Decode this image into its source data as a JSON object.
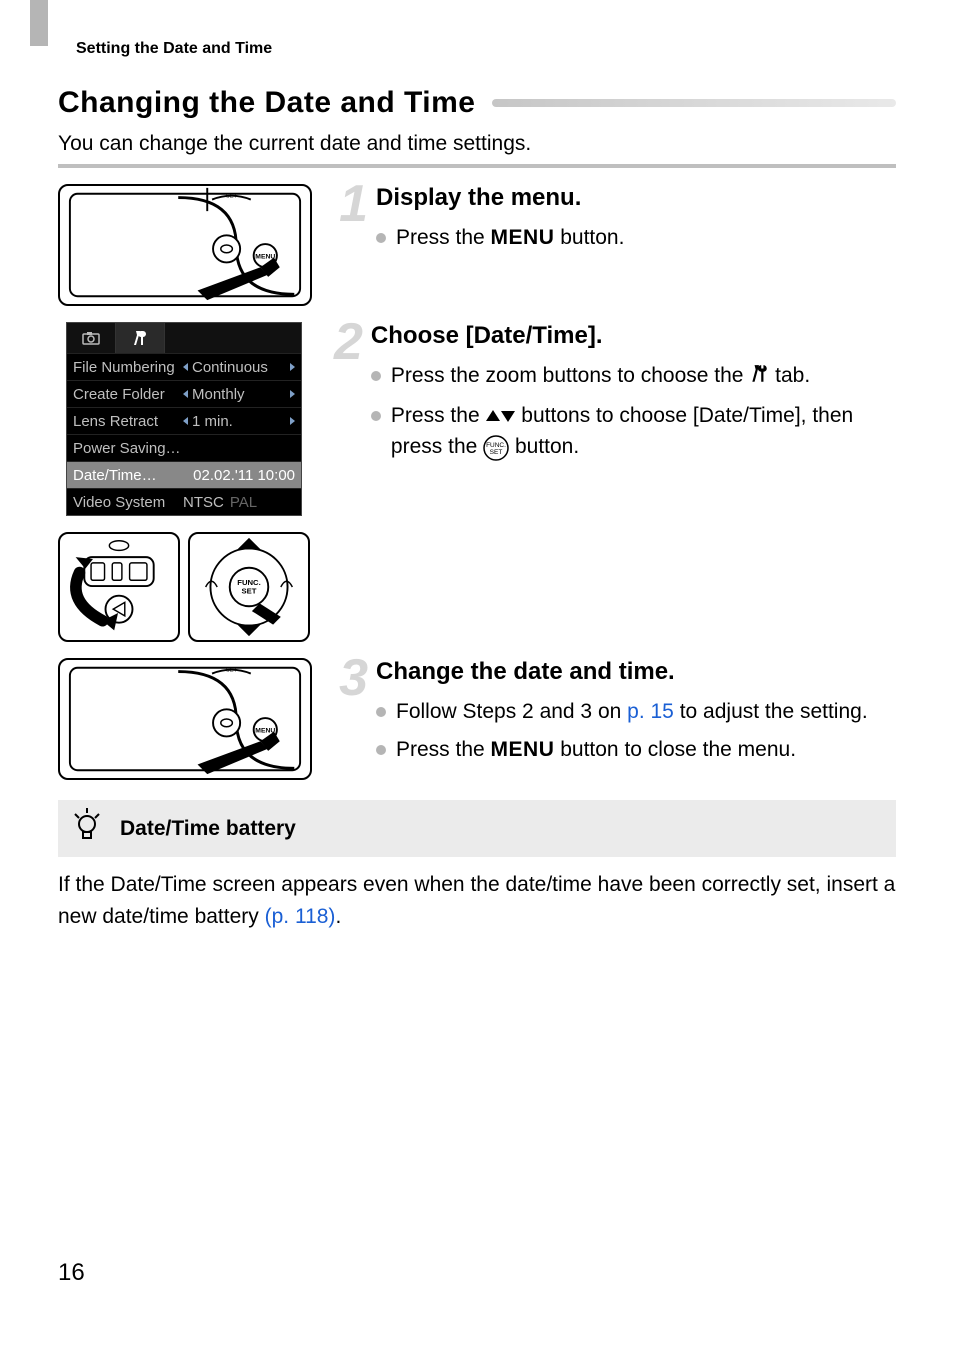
{
  "header": {
    "section": "Setting the Date and Time"
  },
  "title": "Changing the Date and Time",
  "intro": "You can change the current date and time settings.",
  "steps": [
    {
      "num": "1",
      "heading": "Display the menu.",
      "bullets": [
        {
          "pre": "Press the ",
          "menuword": "MENU",
          "post": " button."
        }
      ]
    },
    {
      "num": "2",
      "heading": "Choose [Date/Time].",
      "bullets": [
        {
          "pre": "Press the zoom buttons to choose the ",
          "icon": "tools",
          "post": " tab."
        },
        {
          "pre": "Press the ",
          "icon": "updown",
          "mid": " buttons to choose [Date/Time], then press the ",
          "icon2": "funcset",
          "post": " button."
        }
      ]
    },
    {
      "num": "3",
      "heading": "Change the date and time.",
      "bullets": [
        {
          "pre": "Follow Steps 2 and 3 on ",
          "link": "p. 15",
          "post": " to adjust the setting."
        },
        {
          "pre": "Press the ",
          "menuword": "MENU",
          "post": " button to close the menu."
        }
      ]
    }
  ],
  "menu_screenshot": {
    "rows": [
      {
        "label": "File Numbering",
        "value": "Continuous",
        "arrows": true
      },
      {
        "label": "Create Folder",
        "value": "Monthly",
        "arrows": true
      },
      {
        "label": "Lens Retract",
        "value": "1 min.",
        "arrows": true
      },
      {
        "label": "Power Saving…",
        "value": "",
        "arrows": false
      },
      {
        "label": "Date/Time…",
        "value": "02.02.'11 10:00",
        "arrows": false,
        "selected": true
      },
      {
        "label": "Video System",
        "value": "NTSC",
        "pal": "PAL",
        "arrows": false
      }
    ]
  },
  "tip": {
    "title": "Date/Time battery",
    "text_pre": "If the Date/Time screen appears even when the date/time have been correctly set, insert a new date/time battery ",
    "link": "(p. 118)",
    "text_post": "."
  },
  "page_number": "16"
}
